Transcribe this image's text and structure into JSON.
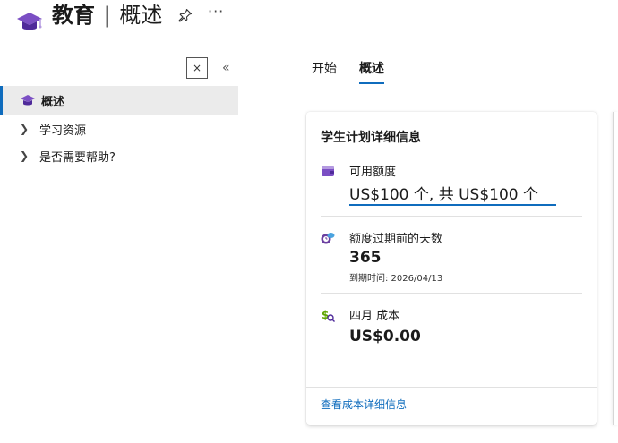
{
  "header": {
    "title_main": "教育",
    "title_separator": "|",
    "title_sub": "概述",
    "pin_icon": "pin-icon",
    "more_label": "···"
  },
  "sidebar": {
    "close_label": "×",
    "collapse_label": "«",
    "items": [
      {
        "label": "概述",
        "icon": "graduation-cap-icon",
        "active": true
      },
      {
        "label": "学习资源",
        "icon": "chevron-right-icon",
        "active": false
      },
      {
        "label": "是否需要帮助?",
        "icon": "chevron-right-icon",
        "active": false
      }
    ]
  },
  "tabs": [
    {
      "label": "开始",
      "active": false
    },
    {
      "label": "概述",
      "active": true
    }
  ],
  "card": {
    "title": "学生计划详细信息",
    "credit": {
      "label": "可用额度",
      "value": "US$100 个, 共 US$100 个",
      "icon": "wallet-icon"
    },
    "days": {
      "label": "额度过期前的天数",
      "value": "365",
      "sub": "到期时间: 2026/04/13",
      "icon": "clock-cloud-icon"
    },
    "cost": {
      "label": "四月 成本",
      "value": "US$0.00",
      "icon": "cost-search-icon"
    },
    "link": "查看成本详细信息"
  },
  "colors": {
    "accent": "#0f6cbd",
    "cap_purple": "#6b3fa0",
    "cost_green": "#5ea500"
  }
}
